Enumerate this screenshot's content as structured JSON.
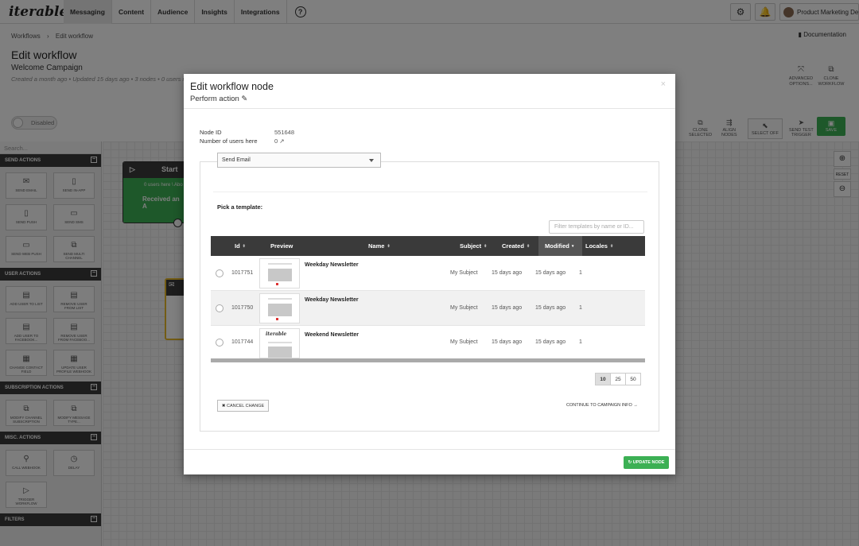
{
  "nav": {
    "logo_text": "iterable",
    "tabs": [
      {
        "label": "Messaging"
      },
      {
        "label": "Content"
      },
      {
        "label": "Audience"
      },
      {
        "label": "Insights"
      },
      {
        "label": "Integrations"
      }
    ],
    "help_glyph": "?",
    "user_label": "Product Marketing De",
    "icons": [
      "gear-icon",
      "bell-icon",
      "avatar"
    ]
  },
  "header": {
    "breadcrumb": [
      "Workflows",
      "›",
      "Edit workflow"
    ],
    "documentation": "Documentation",
    "title": "Edit workflow",
    "campaign_name": "Welcome Campaign",
    "meta": "Created a month ago • Updated 15 days ago • 3 nodes • 0 users in b",
    "actions": [
      {
        "label_1": "ADVANCED",
        "label_2": "OPTIONS..."
      },
      {
        "label_1": "CLONE",
        "label_2": "WORKFLOW"
      }
    ]
  },
  "toolbar": {
    "toggle_label": "Disabled",
    "buttons": [
      {
        "label_1": "CLONE",
        "label_2": "SELECTED"
      },
      {
        "label_1": "ALIGN",
        "label_2": "NODES"
      },
      {
        "label_1": "SELECT OFF",
        "label_2": ""
      },
      {
        "label_1": "SEND TEST",
        "label_2": "TRIGGER"
      }
    ],
    "save_label": "SAVE"
  },
  "sidebar": {
    "search_placeholder": "Search...",
    "sections": [
      {
        "title": "SEND ACTIONS",
        "items": [
          {
            "l1": "SEND EMAIL",
            "l2": ""
          },
          {
            "l1": "SEND IN-APP",
            "l2": ""
          },
          {
            "l1": "SEND PUSH",
            "l2": ""
          },
          {
            "l1": "SEND SMS",
            "l2": ""
          },
          {
            "l1": "SEND WEB PUSH",
            "l2": ""
          },
          {
            "l1": "SEND MULTI",
            "l2": "CHANNEL"
          }
        ]
      },
      {
        "title": "USER ACTIONS",
        "items": [
          {
            "l1": "ADD USER TO LIST",
            "l2": ""
          },
          {
            "l1": "REMOVE USER",
            "l2": "FROM LIST"
          },
          {
            "l1": "ADD USER TO",
            "l2": "FACEBOOK..."
          },
          {
            "l1": "REMOVE USER",
            "l2": "FROM FACEBOO..."
          },
          {
            "l1": "CHANGE CONTACT",
            "l2": "FIELD"
          },
          {
            "l1": "UPDATE USER",
            "l2": "PROFILE WEBHOOK"
          }
        ]
      },
      {
        "title": "SUBSCRIPTION ACTIONS",
        "items": [
          {
            "l1": "MODIFY CHANNEL",
            "l2": "SUBSCRIPTION"
          },
          {
            "l1": "MODIFY MESSAGE",
            "l2": "TYPE..."
          }
        ]
      },
      {
        "title": "MISC. ACTIONS",
        "items": [
          {
            "l1": "CALL WEBHOOK",
            "l2": ""
          },
          {
            "l1": "DELAY",
            "l2": ""
          },
          {
            "l1": "TRIGGER",
            "l2": "WORKFLOW"
          }
        ]
      },
      {
        "title": "FILTERS",
        "items": []
      }
    ]
  },
  "canvas": {
    "start_title": "Start",
    "start_text": "0 users here \\ Abo",
    "start_event": "Received an A",
    "zoom_reset": "RESET"
  },
  "modal": {
    "title": "Edit workflow node",
    "subtitle": "Perform action",
    "close_glyph": "×",
    "node_id_label": "Node ID",
    "node_id_value": "551648",
    "users_label": "Number of users here",
    "users_value": "0",
    "action_select": "Send Email",
    "pick_label": "Pick a template:",
    "filter_placeholder": "Filter templates by name or ID...",
    "table": {
      "columns": [
        "Id",
        "Preview",
        "Name",
        "Subject",
        "Created",
        "Modified",
        "Locales"
      ],
      "rows": [
        {
          "id": "1017751",
          "name": "Weekday Newsletter",
          "subject": "My Subject",
          "created": "15 days ago",
          "modified": "15 days ago",
          "locales": "1",
          "preview": "photo"
        },
        {
          "id": "1017750",
          "name": "Weekday Newsletter",
          "subject": "My Subject",
          "created": "15 days ago",
          "modified": "15 days ago",
          "locales": "1",
          "preview": "photo"
        },
        {
          "id": "1017744",
          "name": "Weekend Newsletter",
          "subject": "My Subject",
          "created": "15 days ago",
          "modified": "15 days ago",
          "locales": "1",
          "preview": "logo"
        }
      ]
    },
    "preview_logo_text": "iterable",
    "page_sizes": [
      "10",
      "25",
      "50"
    ],
    "page_size_selected": "10",
    "cancel_label": "✖ CANCEL CHANGE",
    "continue_label": "CONTINUE TO CAMPAIGN INFO →",
    "update_label": "↻ UPDATE NODE"
  }
}
